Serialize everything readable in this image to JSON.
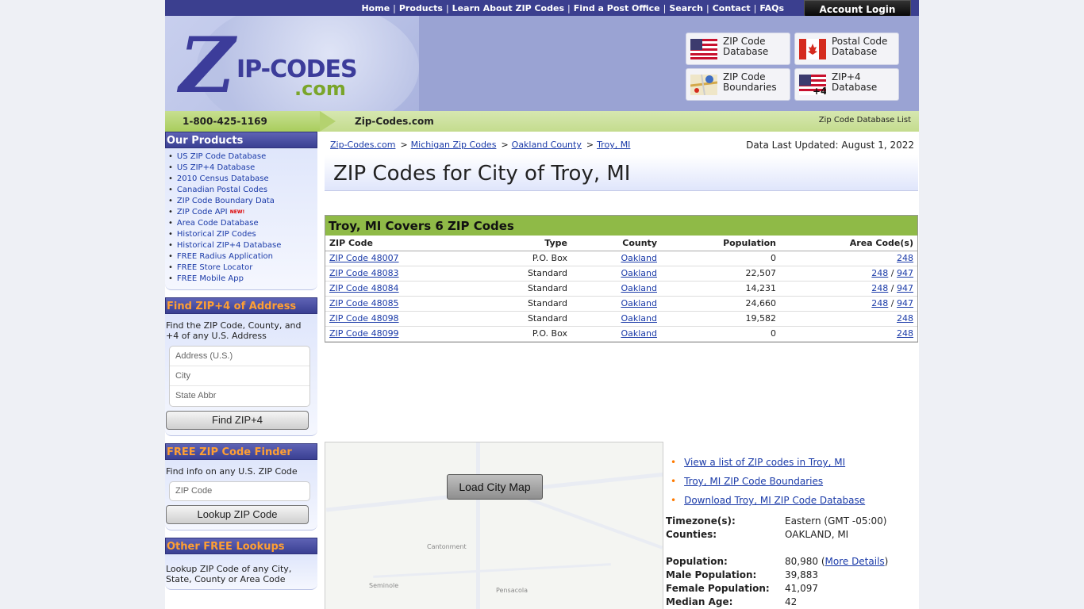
{
  "nav": {
    "links": [
      "Home",
      "Products",
      "Learn About ZIP Codes",
      "Find a Post Office",
      "Search",
      "Contact",
      "FAQs"
    ],
    "login": "Account Login"
  },
  "logo": {
    "z": "Z",
    "rest": "IP-CODES",
    "com": ".com"
  },
  "tiles": [
    {
      "line1": "ZIP Code",
      "line2": "Database",
      "icon": "us-flag-icon"
    },
    {
      "line1": "Postal Code",
      "line2": "Database",
      "icon": "canada-flag-icon"
    },
    {
      "line1": "ZIP Code",
      "line2": "Boundaries",
      "icon": "map-icon"
    },
    {
      "line1": "ZIP+4",
      "line2": "Database",
      "icon": "us-flag-plus4-icon"
    }
  ],
  "greenbar": {
    "phone": "1-800-425-1169",
    "site": "Zip-Codes.com",
    "right": "Zip Code Database List"
  },
  "sidebar": {
    "products_title": "Our Products",
    "products": [
      "US ZIP Code Database",
      "US ZIP+4 Database",
      "2010 Census Database",
      "Canadian Postal Codes",
      "ZIP Code Boundary Data",
      "ZIP Code API",
      "Area Code Database",
      "Historical ZIP Codes",
      "Historical ZIP+4 Database",
      "FREE Radius Application",
      "FREE Store Locator",
      "FREE Mobile App"
    ],
    "new_badge": "NEW!",
    "zip4_title": "Find ZIP+4 of Address",
    "zip4_text": "Find the ZIP Code, County, and +4 of any U.S. Address",
    "zip4_fields": [
      "Address (U.S.)",
      "City",
      "State Abbr"
    ],
    "zip4_button": "Find ZIP+4",
    "finder_title": "FREE ZIP Code Finder",
    "finder_text": "Find info on any U.S. ZIP Code",
    "finder_placeholder": "ZIP Code",
    "finder_button": "Lookup ZIP Code",
    "other_title": "Other FREE Lookups",
    "other_text": "Lookup ZIP Code of any City, State, County or Area Code"
  },
  "breadcrumb": [
    "Zip-Codes.com",
    "Michigan Zip Codes",
    "Oakland County",
    "Troy, MI"
  ],
  "updated": "Data Last Updated: August 1, 2022",
  "title": "ZIP Codes for City of Troy, MI",
  "table": {
    "heading": "Troy, MI Covers 6 ZIP Codes",
    "columns": [
      "ZIP Code",
      "Type",
      "County",
      "Population",
      "Area Code(s)"
    ],
    "rows": [
      {
        "zip": "ZIP Code 48007",
        "type": "P.O. Box",
        "county": "Oakland",
        "pop": "0",
        "codes": [
          "248"
        ]
      },
      {
        "zip": "ZIP Code 48083",
        "type": "Standard",
        "county": "Oakland",
        "pop": "22,507",
        "codes": [
          "248",
          "947"
        ]
      },
      {
        "zip": "ZIP Code 48084",
        "type": "Standard",
        "county": "Oakland",
        "pop": "14,231",
        "codes": [
          "248",
          "947"
        ]
      },
      {
        "zip": "ZIP Code 48085",
        "type": "Standard",
        "county": "Oakland",
        "pop": "24,660",
        "codes": [
          "248",
          "947"
        ]
      },
      {
        "zip": "ZIP Code 48098",
        "type": "Standard",
        "county": "Oakland",
        "pop": "19,582",
        "codes": [
          "248"
        ]
      },
      {
        "zip": "ZIP Code 48099",
        "type": "P.O. Box",
        "county": "Oakland",
        "pop": "0",
        "codes": [
          "248"
        ]
      }
    ]
  },
  "map": {
    "button": "Load City Map",
    "labels": [
      "Cantonment",
      "Seminole",
      "Pensacola"
    ]
  },
  "links": [
    "View a list of ZIP codes in Troy, MI",
    "Troy, MI ZIP Code Boundaries",
    "Download Troy, MI ZIP Code Database"
  ],
  "facts": [
    {
      "k": "Timezone(s):",
      "v": "Eastern (GMT -05:00)"
    },
    {
      "k": "Counties:",
      "v": "OAKLAND, MI"
    },
    {
      "k": "",
      "v": ""
    },
    {
      "k": "Population:",
      "v": "80,980",
      "link": "More Details"
    },
    {
      "k": "Male Population:",
      "v": "39,883"
    },
    {
      "k": "Female Population:",
      "v": "41,097"
    },
    {
      "k": "Median Age:",
      "v": "42"
    }
  ]
}
